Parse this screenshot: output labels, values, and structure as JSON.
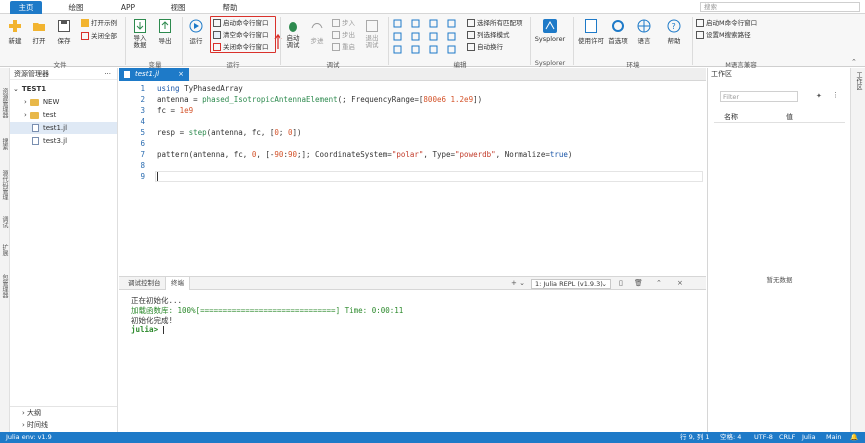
{
  "menu": {
    "tabs": [
      "主页",
      "绘图",
      "APP",
      "视图",
      "帮助"
    ],
    "active_tab": "主页",
    "search_placeholder": "搜索"
  },
  "ribbon": {
    "file": {
      "new": "新建",
      "open": "打开",
      "save": "保存",
      "open_example": "打开示例",
      "close_all": "关闭全部",
      "group": "文件"
    },
    "variables": {
      "import_data": "导入\n数据",
      "export": "导出",
      "group": "变量"
    },
    "run": {
      "run": "运行",
      "start_cmd": "启动命令行窗口",
      "clear_cmd": "清空命令行窗口",
      "close_cmd": "关闭命令行窗口",
      "group": "运行"
    },
    "debug": {
      "start_debug": "启动\n调试",
      "step": "步进",
      "step_in": "步入",
      "step_out": "步出",
      "restart": "重启",
      "exit_debug": "退出\n调试",
      "group": "调试"
    },
    "edit": {
      "select_all_matches": "选择所有匹配项",
      "column_select": "列选择模式",
      "word_wrap": "自动换行",
      "group": "编辑"
    },
    "sysplorer": {
      "label": "Sysplorer",
      "group": "Sysplorer"
    },
    "env": {
      "license": "使用许可",
      "preferences": "首选项",
      "language": "语言",
      "help": "帮助",
      "group": "环境"
    },
    "mlang": {
      "start_m_cmd": "启动M命令行窗口",
      "set_m_path": "设置M搜索路径",
      "group": "M语言兼容"
    }
  },
  "activity_bar": [
    "资源管理器",
    "搜索",
    "源代码管理",
    "调试",
    "扩展",
    "包管理器"
  ],
  "explorer": {
    "header": "资源管理器",
    "project": "TEST1",
    "items": [
      {
        "label": "NEW",
        "type": "folder"
      },
      {
        "label": "test",
        "type": "folder"
      },
      {
        "label": "test1.jl",
        "type": "file"
      },
      {
        "label": "test3.jl",
        "type": "file"
      }
    ],
    "outline": "大纲",
    "timeline": "时间线"
  },
  "editor": {
    "tab_label": "test1.jl",
    "line_numbers": [
      "1",
      "2",
      "3",
      "4",
      "5",
      "6",
      "7",
      "8",
      "9"
    ]
  },
  "terminal": {
    "tabs": [
      "调试控制台",
      "终端"
    ],
    "active_tab": "终端",
    "repl": "1: Julia REPL (v1.9.3)",
    "lines": {
      "init": "正在初始化...",
      "loading": "加载函数库: 100%[==============================] Time: 0:00:11",
      "done": "初始化完成!",
      "prompt": "julia> "
    }
  },
  "workspace": {
    "title": "工作区",
    "filter_placeholder": "Filter",
    "col_name": "名称",
    "col_value": "值",
    "empty": "暂无数据",
    "side_tab": "工作区"
  },
  "status": {
    "env": "Julia env: v1.9",
    "position": "行 9, 列 1",
    "spaces": "空格: 4",
    "encoding": "UTF-8",
    "eol": "CRLF",
    "language": "Julia",
    "branch": "Main"
  },
  "colors": {
    "accent": "#1e7ac8",
    "highlight_box": "#d9312b"
  }
}
